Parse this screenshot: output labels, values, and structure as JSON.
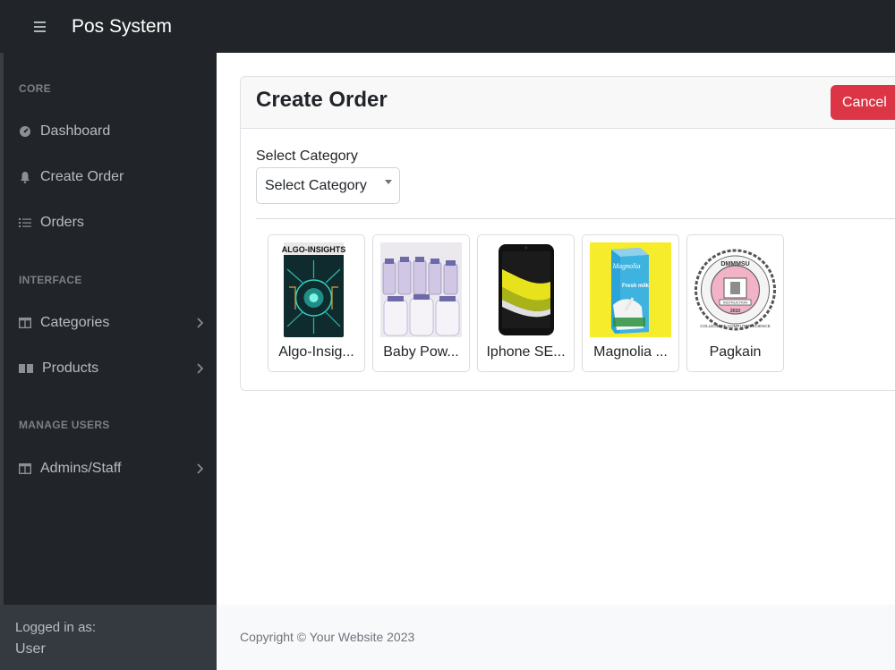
{
  "app": {
    "title": "Pos System"
  },
  "sidebar": {
    "sections": [
      {
        "heading": "CORE"
      },
      {
        "heading": "INTERFACE"
      },
      {
        "heading": "MANAGE USERS"
      }
    ],
    "items": [
      {
        "label": "Dashboard",
        "icon": "dashboard-icon"
      },
      {
        "label": "Create Order",
        "icon": "bell-icon"
      },
      {
        "label": "Orders",
        "icon": "list-icon"
      },
      {
        "label": "Categories",
        "icon": "columns-icon"
      },
      {
        "label": "Products",
        "icon": "book-icon"
      },
      {
        "label": "Admins/Staff",
        "icon": "columns-icon"
      }
    ],
    "footer": {
      "logged_in_label": "Logged in as:",
      "user": "User"
    }
  },
  "main": {
    "card_title": "Create Order",
    "cancel_label": "Cancel",
    "category_label": "Select Category",
    "category_select": {
      "selected": "Select Category"
    },
    "products": [
      {
        "name": "Algo-Insig...",
        "image_text": "ALGO-INSIGHTS"
      },
      {
        "name": "Baby Pow..."
      },
      {
        "name": "Iphone SE..."
      },
      {
        "name": "Magnolia ...",
        "image_text": "Magnolia",
        "image_subtext": "Fresh milk"
      },
      {
        "name": "Pagkain",
        "image_text": "DMMMSU",
        "image_subtext": "COLLEGE OF COMPUTER SCIENCE",
        "image_year": "2010",
        "image_banner": "INSTRUCTION"
      }
    ]
  },
  "footer": {
    "copyright": "Copyright © Your Website 2023"
  },
  "colors": {
    "dark": "#212529",
    "danger": "#dc3545",
    "muted": "#6c757d"
  }
}
